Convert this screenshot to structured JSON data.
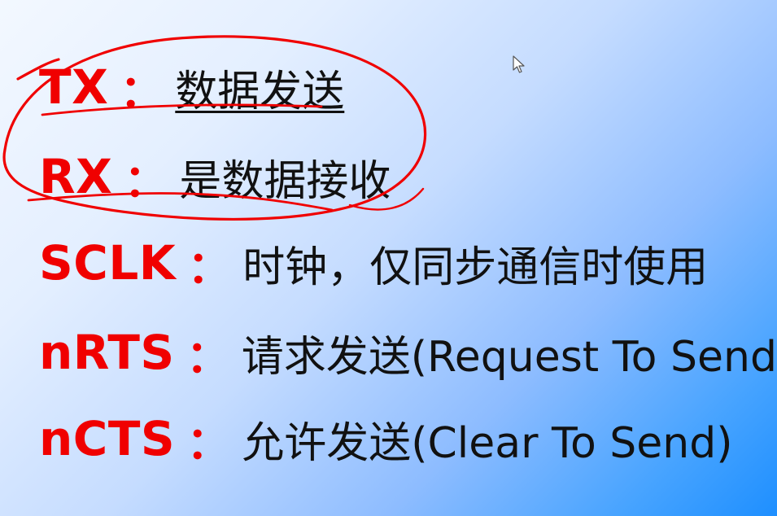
{
  "slide": {
    "items": [
      {
        "term": "TX",
        "separator": "：",
        "description": "数据发送"
      },
      {
        "term": "RX",
        "separator": "：",
        "description": "是数据接收"
      },
      {
        "term": "SCLK",
        "separator": "：",
        "description": "时钟，仅同步通信时使用"
      },
      {
        "term": "nRTS",
        "separator": "：",
        "description": "请求发送(Request To Send)"
      },
      {
        "term": "nCTS",
        "separator": "：",
        "description": "允许发送(Clear To Send)"
      }
    ],
    "colors": {
      "term": "#f00000",
      "description": "#111111",
      "annotation": "#f00000",
      "background_start": "#f3f8ff",
      "background_end": "#1e8fff"
    },
    "icons": {
      "cursor": "mouse-pointer-icon"
    }
  }
}
